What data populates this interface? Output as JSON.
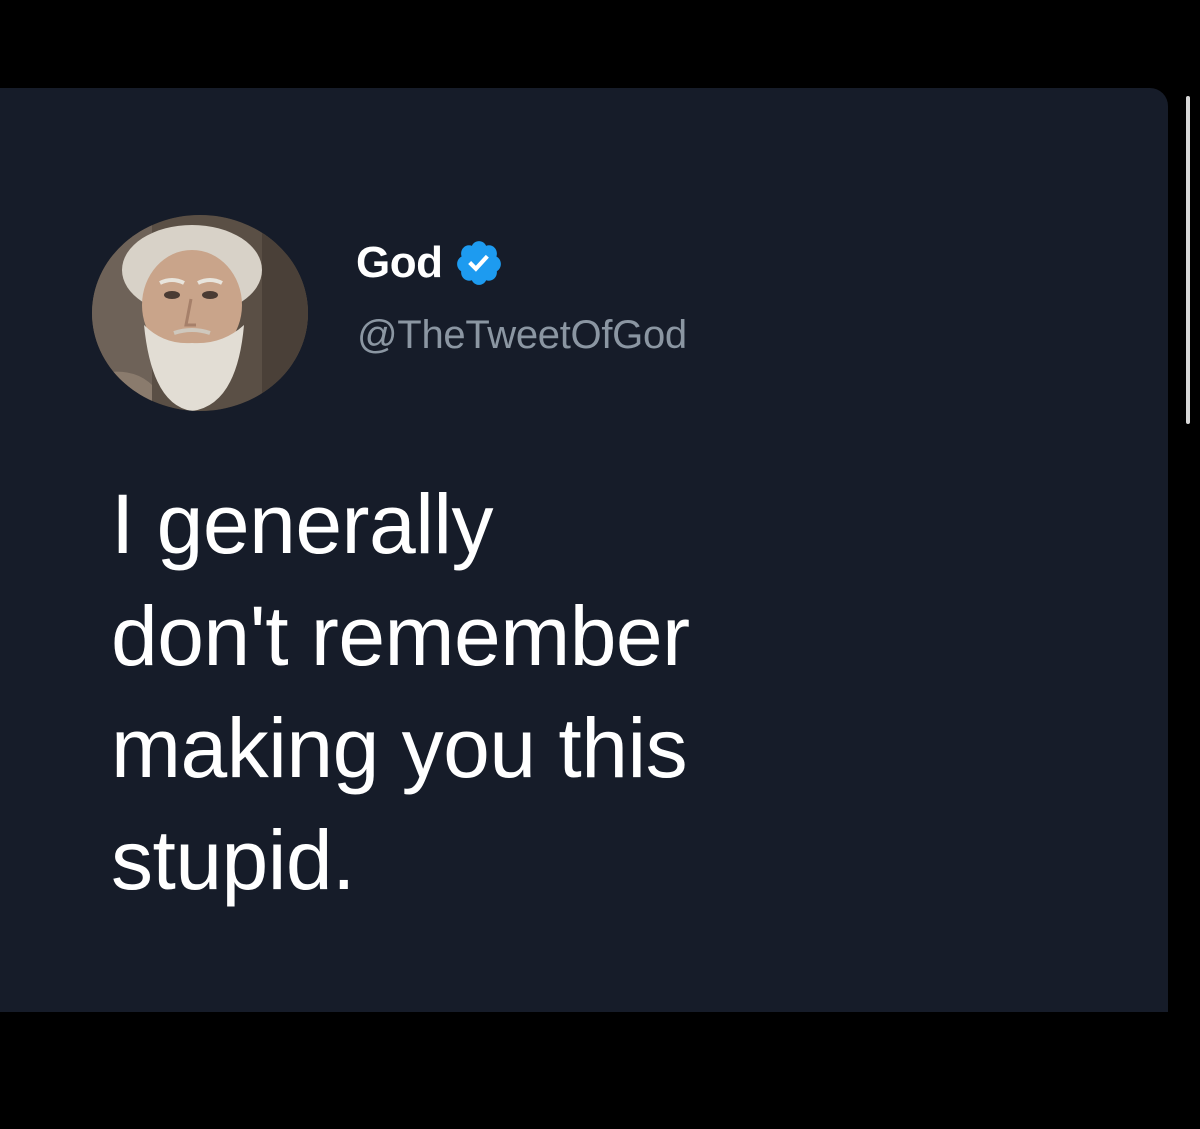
{
  "tweet": {
    "author": {
      "display_name": "God",
      "handle": "@TheTweetOfGod",
      "verified_icon": "verified-badge-icon",
      "avatar_icon": "bearded-man-portrait"
    },
    "text": "I generally\ndon't remember\nmaking you this\nstupid."
  },
  "colors": {
    "page_background": "#000000",
    "card_background": "#161c29",
    "verified_blue": "#1d9bf0",
    "handle_gray": "#8b96a2",
    "text_white": "#ffffff"
  }
}
